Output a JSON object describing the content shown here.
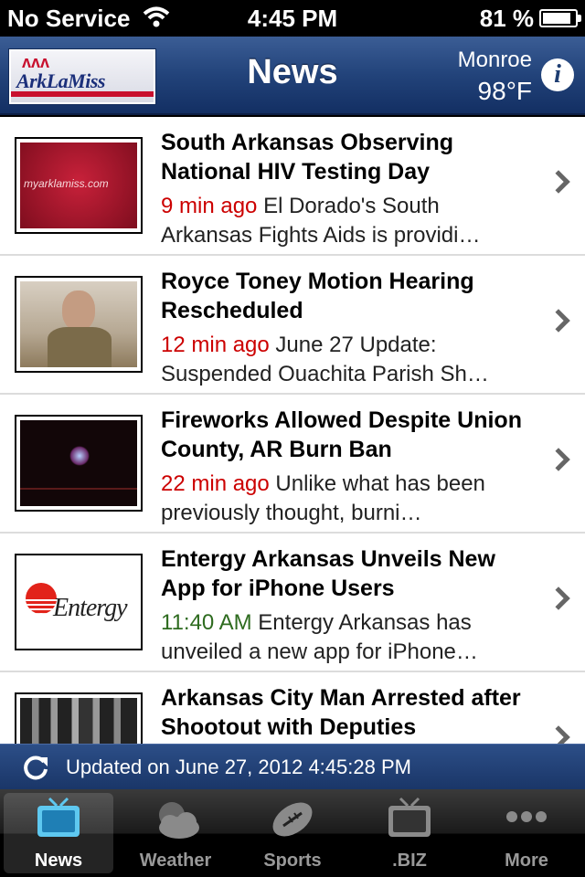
{
  "status_bar": {
    "carrier": "No Service",
    "time": "4:45 PM",
    "battery": "81 %",
    "battery_level": 0.81
  },
  "nav": {
    "logo_text": "ArkLaMiss",
    "title": "News",
    "city": "Monroe",
    "temperature": "98°F",
    "info_label": "i"
  },
  "news": [
    {
      "headline": "South Arkansas Observing National HIV Testing Day",
      "time": "9 min ago",
      "summary": "El Dorado's South Arkansas Fights Aids is providi…"
    },
    {
      "headline": "Royce Toney Motion Hearing Rescheduled",
      "time": "12 min ago",
      "summary": "June 27 Update: Suspended Ouachita Parish Sh…"
    },
    {
      "headline": "Fireworks Allowed Despite Union County, AR Burn Ban",
      "time": "22 min ago",
      "summary": "Unlike what has been previously thought, burni…"
    },
    {
      "headline": "Entergy Arkansas Unveils New App for iPhone Users",
      "time": "11:40 AM",
      "summary": "Entergy Arkansas has unveiled a new app for iPhone…",
      "thumb_text": "Entergy"
    },
    {
      "headline": "Arkansas City Man Arrested after Shootout with Deputies",
      "time": "",
      "summary": ""
    }
  ],
  "updated": {
    "text": "Updated on June 27, 2012 4:45:28 PM"
  },
  "tabs": [
    {
      "label": "News",
      "icon": "tv-icon",
      "active": true
    },
    {
      "label": "Weather",
      "icon": "cloud-sun-icon",
      "active": false
    },
    {
      "label": "Sports",
      "icon": "football-icon",
      "active": false
    },
    {
      "label": ".BIZ",
      "icon": "tv-icon",
      "active": false
    },
    {
      "label": "More",
      "icon": "more-dots-icon",
      "active": false
    }
  ],
  "colors": {
    "nav_blue": "#22437a",
    "time_red": "#cc0000",
    "time_green": "#2e6b1f",
    "active_tab_icon": "#5ec8f0"
  }
}
